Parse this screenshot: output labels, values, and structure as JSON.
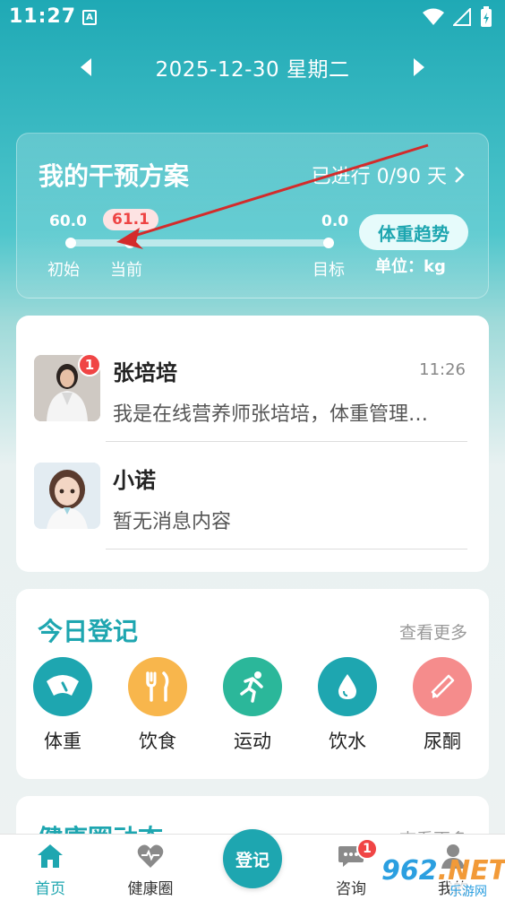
{
  "status_bar": {
    "time": "11:27",
    "notification_icon": "A"
  },
  "date_nav": {
    "date": "2025-12-30 星期二"
  },
  "plan": {
    "title": "我的干预方案",
    "progress_text": "已进行 0/90 天",
    "initial_value": "60.0",
    "current_value": "61.1",
    "target_value": "0.0",
    "initial_label": "初始",
    "current_label": "当前",
    "target_label": "目标",
    "trend_button": "体重趋势",
    "unit": "单位：kg"
  },
  "chats": [
    {
      "name": "张培培",
      "time": "11:26",
      "message": "我是在线营养师张培培，体重管理…",
      "unread": "1"
    },
    {
      "name": "小诺",
      "time": "",
      "message": "暂无消息内容",
      "unread": ""
    }
  ],
  "today": {
    "title": "今日登记",
    "more": "查看更多",
    "items": [
      {
        "label": "体重",
        "icon": "scale-icon",
        "color": "#1ea6b0"
      },
      {
        "label": "饮食",
        "icon": "fork-knife-icon",
        "color": "#f8b64c"
      },
      {
        "label": "运动",
        "icon": "running-icon",
        "color": "#2bb79a"
      },
      {
        "label": "饮水",
        "icon": "water-drop-icon",
        "color": "#1ea6b0"
      },
      {
        "label": "尿酮",
        "icon": "test-strip-icon",
        "color": "#f58c8c"
      }
    ]
  },
  "community": {
    "title": "健康圈动态",
    "more": "查看更多"
  },
  "bottom_nav": {
    "home": "首页",
    "health": "健康圈",
    "register": "登记",
    "consult": "咨询",
    "consult_badge": "1",
    "mine": "我的"
  },
  "watermark": {
    "logo": "962.NET",
    "sub": "乐游网"
  },
  "colors": {
    "accent": "#1ea6b0",
    "badge": "#f04545",
    "annotation_arrow": "#d32b2b"
  }
}
